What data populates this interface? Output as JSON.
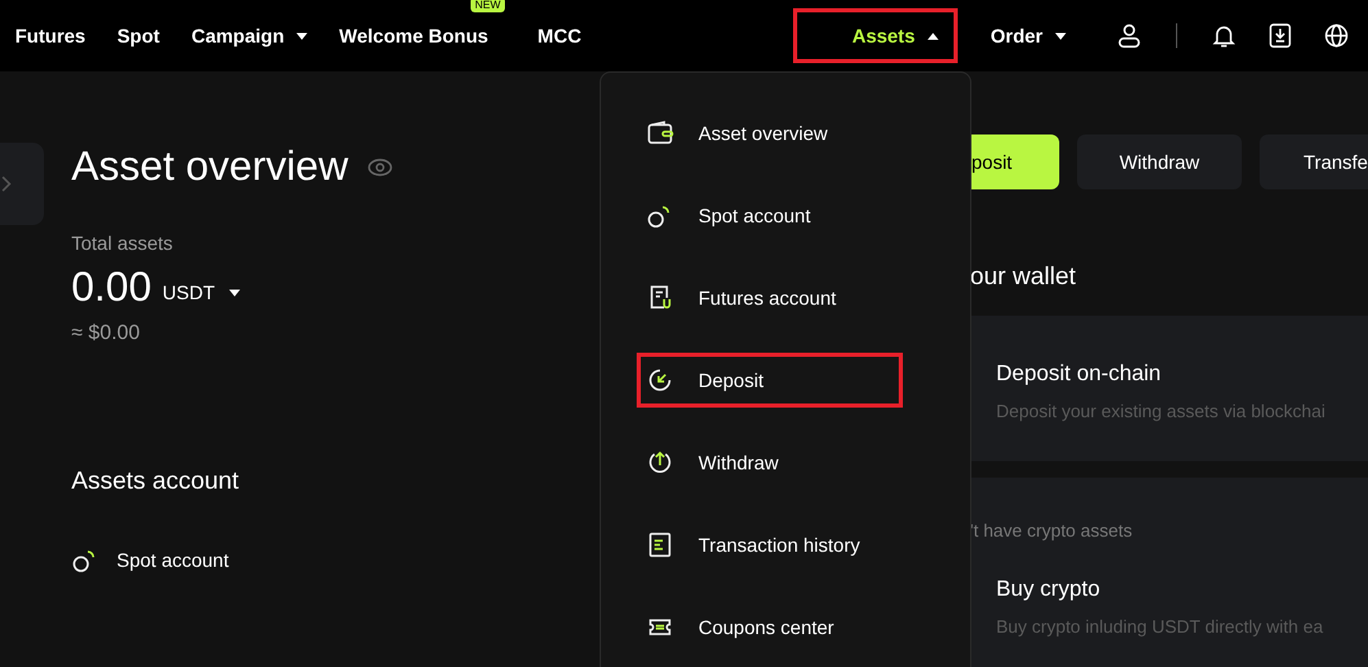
{
  "nav": {
    "items": [
      {
        "label": "Futures",
        "kind": "link"
      },
      {
        "label": "Spot",
        "kind": "link"
      },
      {
        "label": "Campaign",
        "kind": "dropdown"
      },
      {
        "label": "Welcome Bonus",
        "kind": "link",
        "badge": "NEW"
      },
      {
        "label": "MCC",
        "kind": "link"
      }
    ],
    "right_items": [
      {
        "label": "Assets",
        "expanded": true,
        "selected": true,
        "highlighted": true
      },
      {
        "label": "Order",
        "expanded": false,
        "selected": false,
        "highlighted": false
      }
    ]
  },
  "overview": {
    "title": "Asset overview",
    "total_label": "Total assets",
    "amount": "0.00",
    "currency": "USDT",
    "approx": "≈ $0.00",
    "accounts_title": "Assets account",
    "accounts": [
      {
        "label": "Spot account"
      }
    ]
  },
  "dropdown": {
    "items": [
      {
        "label": "Asset overview",
        "highlighted": false
      },
      {
        "label": "Spot account",
        "highlighted": false
      },
      {
        "label": "Futures account",
        "highlighted": false
      },
      {
        "label": "Deposit",
        "highlighted": true
      },
      {
        "label": "Withdraw",
        "highlighted": false
      },
      {
        "label": "Transaction history",
        "highlighted": false
      },
      {
        "label": "Coupons center",
        "highlighted": false
      }
    ]
  },
  "actions": [
    {
      "label": "posit",
      "primary": true
    },
    {
      "label": "Withdraw",
      "primary": false
    },
    {
      "label": "Transfe",
      "primary": false
    }
  ],
  "wallet": {
    "title": "our wallet",
    "cards": [
      {
        "title": "Deposit on-chain",
        "description": "Deposit your existing assets via blockchai"
      },
      {
        "note": "'t have crypto assets",
        "title": "Buy crypto",
        "description": "Buy crypto inluding USDT directly with ea"
      }
    ]
  }
}
